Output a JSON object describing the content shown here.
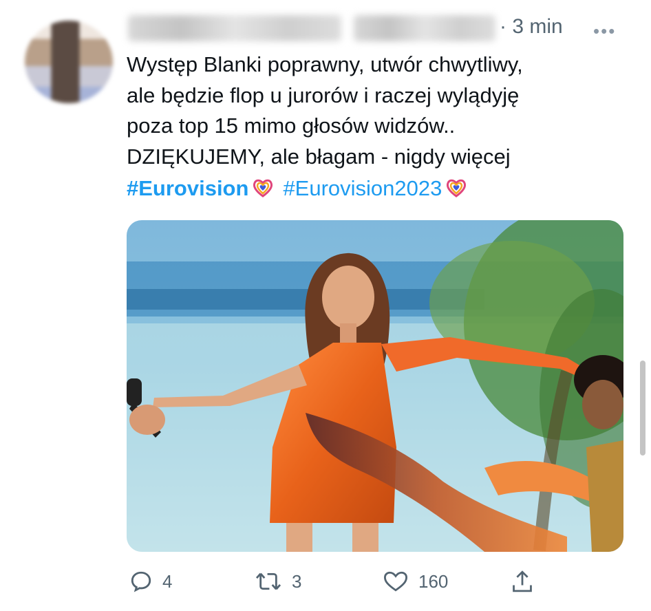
{
  "tweet": {
    "time": "· 3 min",
    "more": "•••",
    "lines": [
      "Występ Blanki poprawny, utwór chwytliwy,",
      "ale będzie flop u jurorów i raczej wylądyję",
      "poza top 15 mimo głosów widzów..",
      "DZIĘKUJEMY, ale błagam - nigdy więcej"
    ],
    "hashtags": [
      "#Eurovision",
      "#Eurovision2023"
    ]
  },
  "actions": {
    "reply_count": "4",
    "retweet_count": "3",
    "like_count": "160"
  },
  "icons": [
    "reply-icon",
    "retweet-icon",
    "like-icon",
    "share-icon",
    "eurovision-heart-icon"
  ],
  "colors": {
    "link": "#1d9bf0",
    "muted": "#536471"
  }
}
